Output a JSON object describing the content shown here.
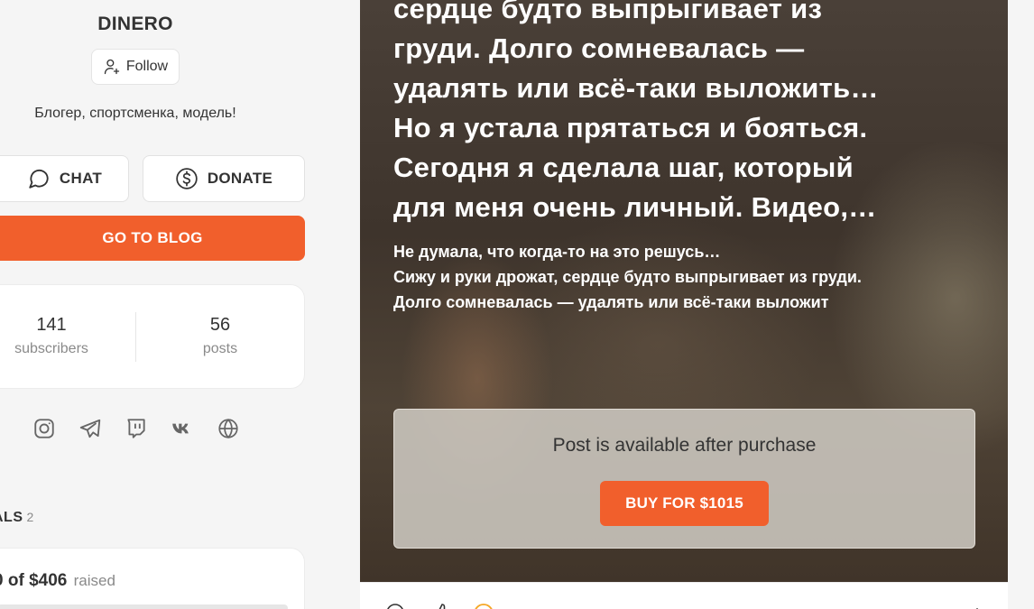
{
  "profile": {
    "name": "DINERO",
    "follow_label": "Follow",
    "bio": "Блогер, спортсменка, модель!"
  },
  "actions": {
    "chat_label": "CHAT",
    "donate_label": "DONATE",
    "blog_label": "GO TO BLOG"
  },
  "stats": {
    "subscribers_count": "141",
    "subscribers_label": "subscribers",
    "posts_count": "56",
    "posts_label": "posts"
  },
  "socials": [
    "instagram-icon",
    "telegram-icon",
    "twitch-icon",
    "vk-icon",
    "globe-icon"
  ],
  "goals": {
    "title": "ALS",
    "count": "2",
    "card": {
      "amount_prefix": "0 of ",
      "amount": "$406",
      "raised_label": "raised"
    }
  },
  "post": {
    "title_lines": [
      "сердце будто выпрыгивает из",
      "груди. Долго сомневалась —",
      "удалять или всё-таки выложить…",
      "Но я устала прятаться и бояться.",
      "Сегодня я сделала шаг, который",
      "для меня очень личный. Видео,…"
    ],
    "excerpt_lines": [
      "Не думала, что когда-то на это решусь…",
      "Сижу и руки дрожат, сердце будто выпрыгивает из груди.",
      "Долго сомневалась — удалять или всё-таки выложит"
    ],
    "paywall_text": "Post is available after purchase",
    "buy_label": "BUY FOR $1015"
  },
  "colors": {
    "accent": "#f15f2c",
    "background": "#f5f5f5",
    "card": "#ffffff"
  }
}
